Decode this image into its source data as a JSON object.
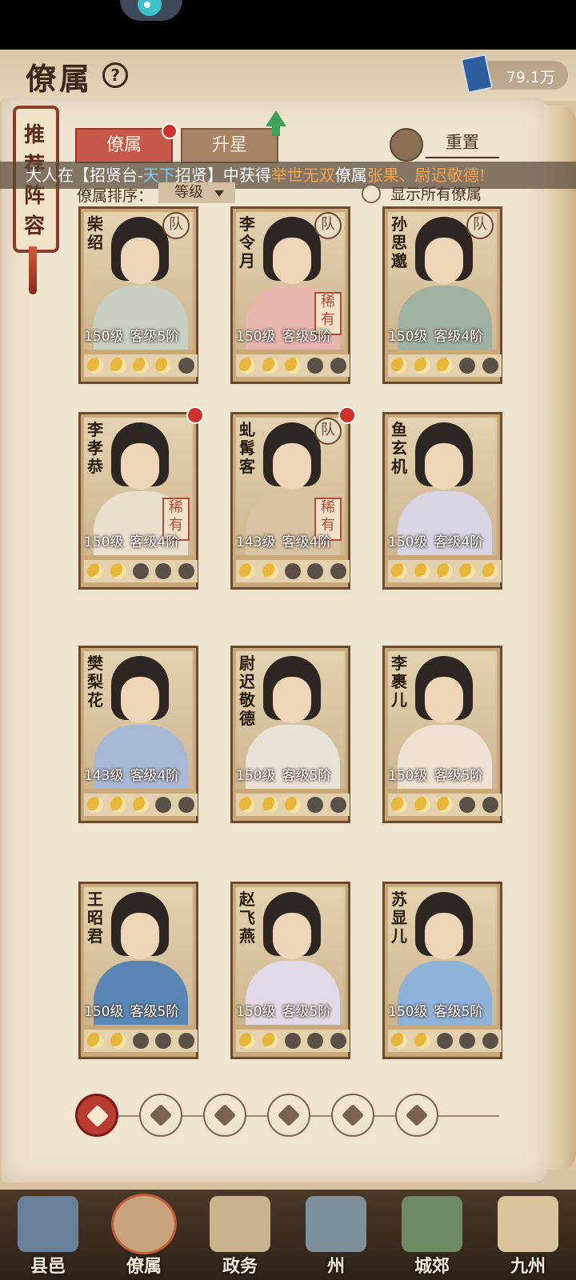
{
  "header": {
    "title": "僚属",
    "currency_value": "79.1万"
  },
  "side_scroll": {
    "label": "推荐阵容"
  },
  "tabs": [
    {
      "label": "僚属",
      "active": true,
      "badge": true
    },
    {
      "label": "升星",
      "active": false,
      "badge": false
    }
  ],
  "reset_label": "重置",
  "marquee": {
    "part1": "大人在【招贤台-",
    "part2": "天下",
    "part3": "招贤】中获得",
    "part4": "举世无双",
    "part5": "僚属",
    "part6": "张果、尉迟敬德",
    "part7": "!"
  },
  "sort": {
    "label": "僚属排序：",
    "value": "等级"
  },
  "show_all_label": "显示所有僚属",
  "cards": [
    {
      "name": "柴绍",
      "level": "150级",
      "rank": "客级5阶",
      "team": "队",
      "rare": "",
      "stars": 4,
      "dot": false,
      "robe": "#c8cfc0"
    },
    {
      "name": "李令月",
      "level": "150级",
      "rank": "客级5阶",
      "team": "队",
      "rare": "稀有",
      "stars": 3,
      "dot": false,
      "robe": "#e7b7ae"
    },
    {
      "name": "孙思邈",
      "level": "150级",
      "rank": "客级4阶",
      "team": "队",
      "rare": "",
      "stars": 3,
      "dot": false,
      "robe": "#9fb2a2"
    },
    {
      "name": "李孝恭",
      "level": "150级",
      "rank": "客级4阶",
      "team": "",
      "rare": "稀有",
      "stars": 2,
      "dot": true,
      "robe": "#e9dfcf"
    },
    {
      "name": "虬髯客",
      "level": "143级",
      "rank": "客级4阶",
      "team": "队",
      "rare": "稀有",
      "stars": 2,
      "dot": true,
      "robe": "#d8c2a2"
    },
    {
      "name": "鱼玄机",
      "level": "150级",
      "rank": "客级4阶",
      "team": "",
      "rare": "",
      "stars": 5,
      "dot": false,
      "robe": "#d8d4e4"
    },
    {
      "name": "樊梨花",
      "level": "143级",
      "rank": "客级4阶",
      "team": "",
      "rare": "",
      "stars": 3,
      "dot": false,
      "robe": "#a9b8d6"
    },
    {
      "name": "尉迟敬德",
      "level": "150级",
      "rank": "客级5阶",
      "team": "",
      "rare": "",
      "stars": 3,
      "dot": false,
      "robe": "#e8e2d6"
    },
    {
      "name": "李裹儿",
      "level": "150级",
      "rank": "客级5阶",
      "team": "",
      "rare": "",
      "stars": 3,
      "dot": false,
      "robe": "#efe1d4"
    },
    {
      "name": "王昭君",
      "level": "150级",
      "rank": "客级5阶",
      "team": "",
      "rare": "",
      "stars": 2,
      "dot": false,
      "robe": "#5a86b6"
    },
    {
      "name": "赵飞燕",
      "level": "150级",
      "rank": "客级5阶",
      "team": "",
      "rare": "",
      "stars": 2,
      "dot": false,
      "robe": "#e2d9e6"
    },
    {
      "name": "苏显儿",
      "level": "150级",
      "rank": "客级5阶",
      "team": "",
      "rare": "",
      "stars": 2,
      "dot": false,
      "robe": "#8fb2d8"
    }
  ],
  "nav": [
    {
      "label": "县邑",
      "art": "#6a7f9a",
      "active": false
    },
    {
      "label": "僚属",
      "art": "#c7a27a",
      "active": true
    },
    {
      "label": "政务",
      "art": "#c8b28c",
      "active": false
    },
    {
      "label": "州",
      "art": "#7f8f9a",
      "active": false
    },
    {
      "label": "城郊",
      "art": "#6f8a62",
      "active": false
    },
    {
      "label": "九州",
      "art": "#d8c39b",
      "active": false
    }
  ]
}
